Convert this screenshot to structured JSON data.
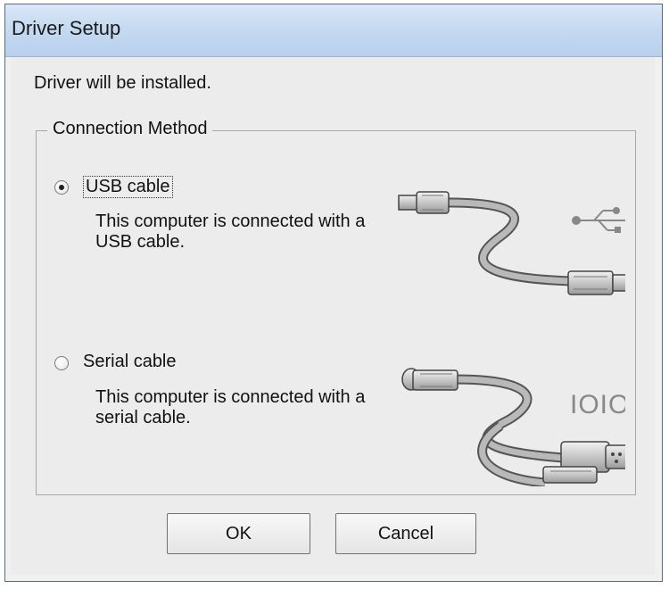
{
  "window": {
    "title": "Driver Setup"
  },
  "dialog": {
    "message": "Driver will be installed.",
    "group_label": "Connection Method",
    "options": [
      {
        "label": "USB cable",
        "description": "This computer is connected with a USB cable.",
        "selected": true,
        "icon": "usb-cable-icon"
      },
      {
        "label": "Serial cable",
        "description": "This computer is connected with a serial cable.",
        "selected": false,
        "icon": "serial-cable-icon"
      }
    ],
    "serial_symbol": "IOIOI"
  },
  "buttons": {
    "ok": "OK",
    "cancel": "Cancel"
  },
  "colors": {
    "titlebar": "#c6daf1",
    "dialog_bg": "#ececec",
    "button_border": "#707070"
  }
}
